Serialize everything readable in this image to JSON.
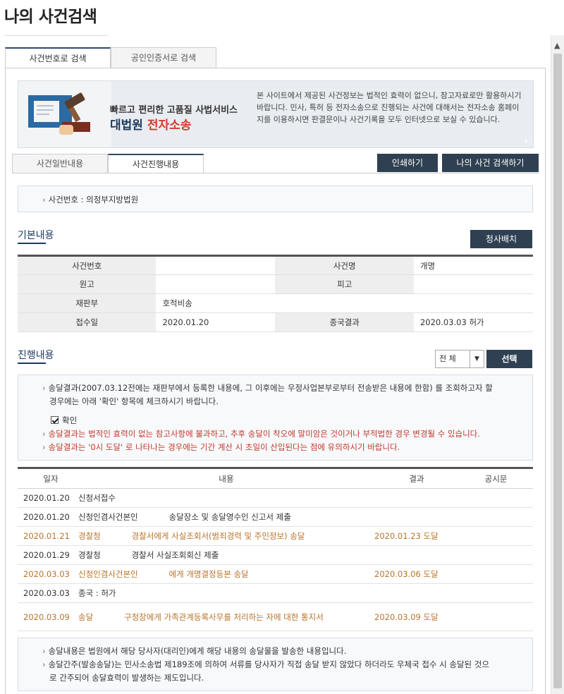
{
  "page": {
    "title": "나의 사건검색"
  },
  "top_tabs": [
    {
      "label": "사건번호로 검색"
    },
    {
      "label": "공인인증서로 검색"
    }
  ],
  "banner": {
    "heading1": "빠르고 편리한 고품질 사법서비스",
    "heading2_a": "대법원 ",
    "heading2_b": "전자소송",
    "text": "본 사이트에서 제공된 사건정보는 법적인 효력이 없으니, 참고자료로만 활용하시기 바랍니다. 민사, 특허 등 전자소송으로 진행되는 사건에 대해서는 전자소송 홈페이지를 이용하시면 판결문이나 사건기록을 모두 인터넷으로 보실 수 있습니다.",
    "plus": "+"
  },
  "mid_tabs": [
    {
      "label": "사건일반내용"
    },
    {
      "label": "사건진행내용"
    }
  ],
  "buttons": {
    "print": "인쇄하기",
    "my_search": "나의 사건 검색하기",
    "assign": "청사배치",
    "select": "선택"
  },
  "case_number_line": "사건번호 : 의정부지방법원",
  "basic": {
    "title": "기본내용",
    "rows": [
      {
        "l1": "사건번호",
        "v1": "",
        "l2": "사건명",
        "v2": "개명"
      },
      {
        "l1": "원고",
        "v1": "",
        "l2": "피고",
        "v2": ""
      },
      {
        "l1": "재판부",
        "v1": "호적비송",
        "l2": "",
        "v2": ""
      },
      {
        "l1": "접수일",
        "v1": "2020.01.20",
        "l2": "종국결과",
        "v2": "2020.03.03 허가"
      }
    ]
  },
  "progress": {
    "title": "진행내용",
    "filter_value": "전 체",
    "notice": {
      "line1": "송달결과(2007.03.12전에는 재판부에서 등록한 내용에, 그 이후에는 우정사업본부로부터 전송받은 내용에 한함) 를 조회하고자 할",
      "line2": "경우에는 아래 '확인' 항목에 체크하시기 바랍니다.",
      "checkbox_label": "확인",
      "red1": "송달결과는 법적인 효력이 없는 참고사항에 불과하고, 추후 송달이 착오에 말미암은 것이거나 부적법한 경우 변경될 수 있습니다.",
      "red2": "송달결과는 '0시 도달' 로 나타나는 경우에는 기간 계산 시 초일이 산입된다는 점에 유의하시기 바랍니다."
    },
    "headers": {
      "date": "일자",
      "content": "내용",
      "result": "결과",
      "notice": "공시문"
    },
    "rows": [
      {
        "date": "2020.01.20",
        "content": "신청서접수",
        "result": "",
        "hl": false
      },
      {
        "date": "2020.01.20",
        "content": "신청인겸사건본인            송달장소 및 송달영수인 신고서 제출",
        "result": "",
        "hl": false
      },
      {
        "date": "2020.01.21",
        "content": "경찰청            경찰서에게 사실조회서(범죄경력 및 주민정보) 송달",
        "result": "2020.01.23 도달",
        "hl": true
      },
      {
        "date": "2020.01.29",
        "content": "경찰청            경찰서 사실조회회신 제출",
        "result": "",
        "hl": false
      },
      {
        "date": "2020.03.03",
        "content": "신청인겸사건본인            에게 개명결정등본 송달",
        "result": "2020.03.06 도달",
        "hl": true
      },
      {
        "date": "2020.03.03",
        "content": "종국 : 허가",
        "result": "",
        "hl": false
      },
      {
        "date": "2020.03.09",
        "content": "송달            구청장에게 가족관계등록사무를 처리하는 자에 대한 통지서",
        "result": "2020.03.09 도달",
        "hl": true
      }
    ]
  },
  "footer": {
    "line1": "송달내용은 법원에서 해당 당사자(대리인)에게 해당 내용의 송달물을 발송한 내용입니다.",
    "line2": "송달간주(발송송달)는 민사소송법 제189조에 의하여 서류를 당사자가 직접 송달 받지 않았다 하더라도 우체국 접수 시 송달된 것으",
    "line3": "로 간주되어 송달효력이 발생하는 제도입니다."
  }
}
